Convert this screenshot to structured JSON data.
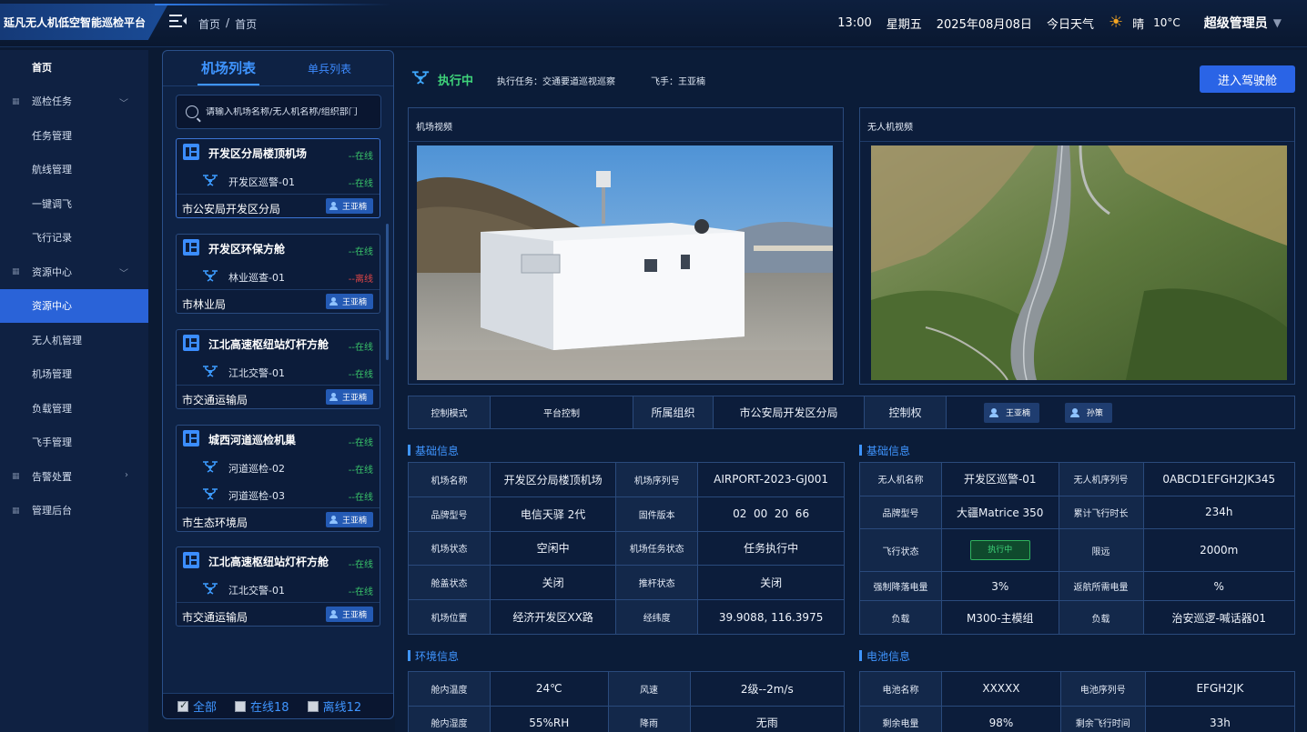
{
  "app": {
    "title": "延凡无人机低空智能巡检平台",
    "breadcrumb": [
      "首页",
      "首页"
    ],
    "breadcrumb_sep": "/"
  },
  "header": {
    "time": "13:00",
    "weekday": "星期五",
    "date": "2025年08月08日",
    "weather_label": "今日天气",
    "weather": "晴",
    "temperature": "10°C",
    "user": "超级管理员"
  },
  "sidebar": {
    "items": [
      {
        "label": "首页"
      },
      {
        "label": "巡检任务"
      },
      {
        "label": "任务管理"
      },
      {
        "label": "航线管理"
      },
      {
        "label": "一键调飞"
      },
      {
        "label": "飞行记录"
      },
      {
        "label": "资源中心"
      },
      {
        "label": "资源中心"
      },
      {
        "label": "无人机管理"
      },
      {
        "label": "机场管理"
      },
      {
        "label": "负载管理"
      },
      {
        "label": "飞手管理"
      },
      {
        "label": "告警处置"
      },
      {
        "label": "管理后台"
      }
    ]
  },
  "list": {
    "tabs": [
      "机场列表",
      "单兵列表"
    ],
    "search_placeholder": "请输入机场名称/无人机名称/组织部门",
    "cards": [
      {
        "name": "开发区分局楼顶机场",
        "status": "--在线",
        "drones": [
          {
            "name": "开发区巡警-01",
            "status": "--在线"
          }
        ],
        "dept": "市公安局开发区分局",
        "pilot": "王亚楠"
      },
      {
        "name": "开发区环保方舱",
        "status": "--在线",
        "drones": [
          {
            "name": "林业巡查-01",
            "status": "--离线"
          }
        ],
        "dept": "市林业局",
        "pilot": "王亚楠"
      },
      {
        "name": "江北高速枢纽站灯杆方舱",
        "status": "--在线",
        "drones": [
          {
            "name": "江北交警-01",
            "status": "--在线"
          }
        ],
        "dept": "市交通运输局",
        "pilot": "王亚楠"
      },
      {
        "name": "城西河道巡检机巢",
        "status": "--在线",
        "drones": [
          {
            "name": "河道巡检-02",
            "status": "--在线"
          },
          {
            "name": "河道巡检-03",
            "status": "--在线"
          }
        ],
        "dept": "市生态环境局",
        "pilot": "王亚楠"
      },
      {
        "name": "江北高速枢纽站灯杆方舱",
        "status": "--在线",
        "drones": [
          {
            "name": "江北交警-01",
            "status": "--在线"
          }
        ],
        "dept": "市交通运输局",
        "pilot": "王亚楠"
      }
    ],
    "filter": {
      "all": "全部",
      "online": "在线18",
      "offline": "离线12"
    }
  },
  "exec": {
    "status": "执行中",
    "task": "执行任务：交通要道巡视巡察",
    "pilot": "飞手：王亚楠",
    "enter_button": "进入驾驶舱"
  },
  "videos": {
    "airport": "机场视频",
    "drone": "无人机视频"
  },
  "control": {
    "mode_key": "控制模式",
    "mode_val": "平台控制",
    "org_key": "所属组织",
    "org_val": "市公安局开发区分局",
    "right_key": "控制权",
    "holders": [
      "王亚楠",
      "孙策"
    ]
  },
  "airport_info": {
    "title": "基础信息",
    "rows": [
      [
        "机场名称",
        "开发区分局楼顶机场",
        "机场序列号",
        "AIRPORT-2023-GJ001"
      ],
      [
        "品牌型号",
        "电信天驿 2代",
        "固件版本",
        "02  00  20  66"
      ],
      [
        "机场状态",
        "空闲中",
        "机场任务状态",
        "任务执行中"
      ],
      [
        "舱盖状态",
        "关闭",
        "推杆状态",
        "关闭"
      ],
      [
        "机场位置",
        "经济开发区XX路",
        "经纬度",
        "39.9088, 116.3975"
      ]
    ]
  },
  "drone_info": {
    "title": "基础信息",
    "rows": [
      [
        "无人机名称",
        "开发区巡警-01",
        "无人机序列号",
        "0ABCD1EFGH2JK345"
      ],
      [
        "品牌型号",
        "大疆Matrice 350",
        "累计飞行时长",
        "234h"
      ],
      [
        "飞行状态",
        "执行中",
        "限远",
        "2000m"
      ],
      [
        "强制降落电量",
        "3%",
        "返航所需电量",
        "%"
      ],
      [
        "负载",
        "M300-主模组",
        "负载",
        "治安巡逻-喊话器01"
      ]
    ]
  },
  "env_info": {
    "title": "环境信息",
    "rows": [
      [
        "舱内温度",
        "24℃",
        "风速",
        "2级--2m/s"
      ],
      [
        "舱内湿度",
        "55%RH",
        "降雨",
        "无雨"
      ]
    ]
  },
  "battery_info": {
    "title": "电池信息",
    "rows": [
      [
        "电池名称",
        "XXXXX",
        "电池序列号",
        "EFGH2JK"
      ],
      [
        "剩余电量",
        "98%",
        "剩余飞行时间",
        "33h"
      ]
    ]
  },
  "colors": {
    "accent": "#3f95ff",
    "online": "#39c46a",
    "offline": "#e04646",
    "executing": "#3fd47a"
  }
}
